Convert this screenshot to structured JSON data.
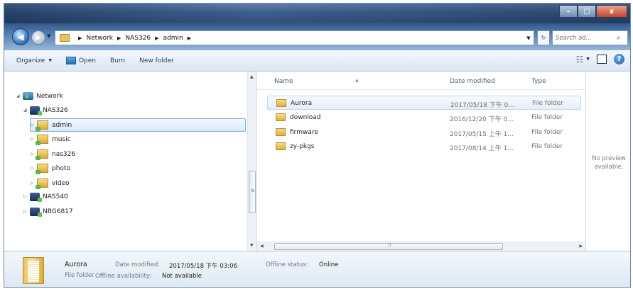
{
  "window": {
    "controls": {
      "minimize": "–",
      "maximize": "□",
      "close": "x"
    }
  },
  "address": {
    "crumbs": [
      "Network",
      "NAS326",
      "admin"
    ],
    "search_placeholder": "Search ad..."
  },
  "toolbar": {
    "organize": "Organize",
    "open": "Open",
    "burn": "Burn",
    "new_folder": "New folder"
  },
  "nav_tree": {
    "items": [
      {
        "label": "Network",
        "level": 0,
        "icon": "network-icon",
        "expanded": true
      },
      {
        "label": "NAS326",
        "level": 1,
        "icon": "nas-icon",
        "expanded": true
      },
      {
        "label": "admin",
        "level": 2,
        "icon": "share-folder-icon",
        "selected": true
      },
      {
        "label": "music",
        "level": 2,
        "icon": "share-folder-icon"
      },
      {
        "label": "nas326",
        "level": 2,
        "icon": "share-folder-icon"
      },
      {
        "label": "photo",
        "level": 2,
        "icon": "share-folder-icon"
      },
      {
        "label": "video",
        "level": 2,
        "icon": "share-folder-icon"
      },
      {
        "label": "NAS540",
        "level": 1,
        "icon": "nas-icon"
      },
      {
        "label": "NBG6817",
        "level": 1,
        "icon": "nas-icon"
      }
    ]
  },
  "file_list": {
    "columns": {
      "name": "Name",
      "date": "Date modified",
      "type": "Type"
    },
    "rows": [
      {
        "name": "Aurora",
        "date": "2017/05/18 下午 0...",
        "type": "File folder",
        "selected": true
      },
      {
        "name": "download",
        "date": "2016/12/20 下午 0...",
        "type": "File folder"
      },
      {
        "name": "firmware",
        "date": "2017/05/15 上午 1...",
        "type": "File folder"
      },
      {
        "name": "zy-pkgs",
        "date": "2017/08/14 上午 1...",
        "type": "File folder"
      }
    ]
  },
  "preview": {
    "line1": "No preview",
    "line2": "available."
  },
  "details": {
    "name": "Aurora",
    "type": "File folder",
    "date_label": "Date modified:",
    "date_value": "2017/05/18 下午 03:06",
    "offline_status_label": "Offline status:",
    "offline_status_value": "Online",
    "offline_avail_label": "Offline availability:",
    "offline_avail_value": "Not available"
  }
}
